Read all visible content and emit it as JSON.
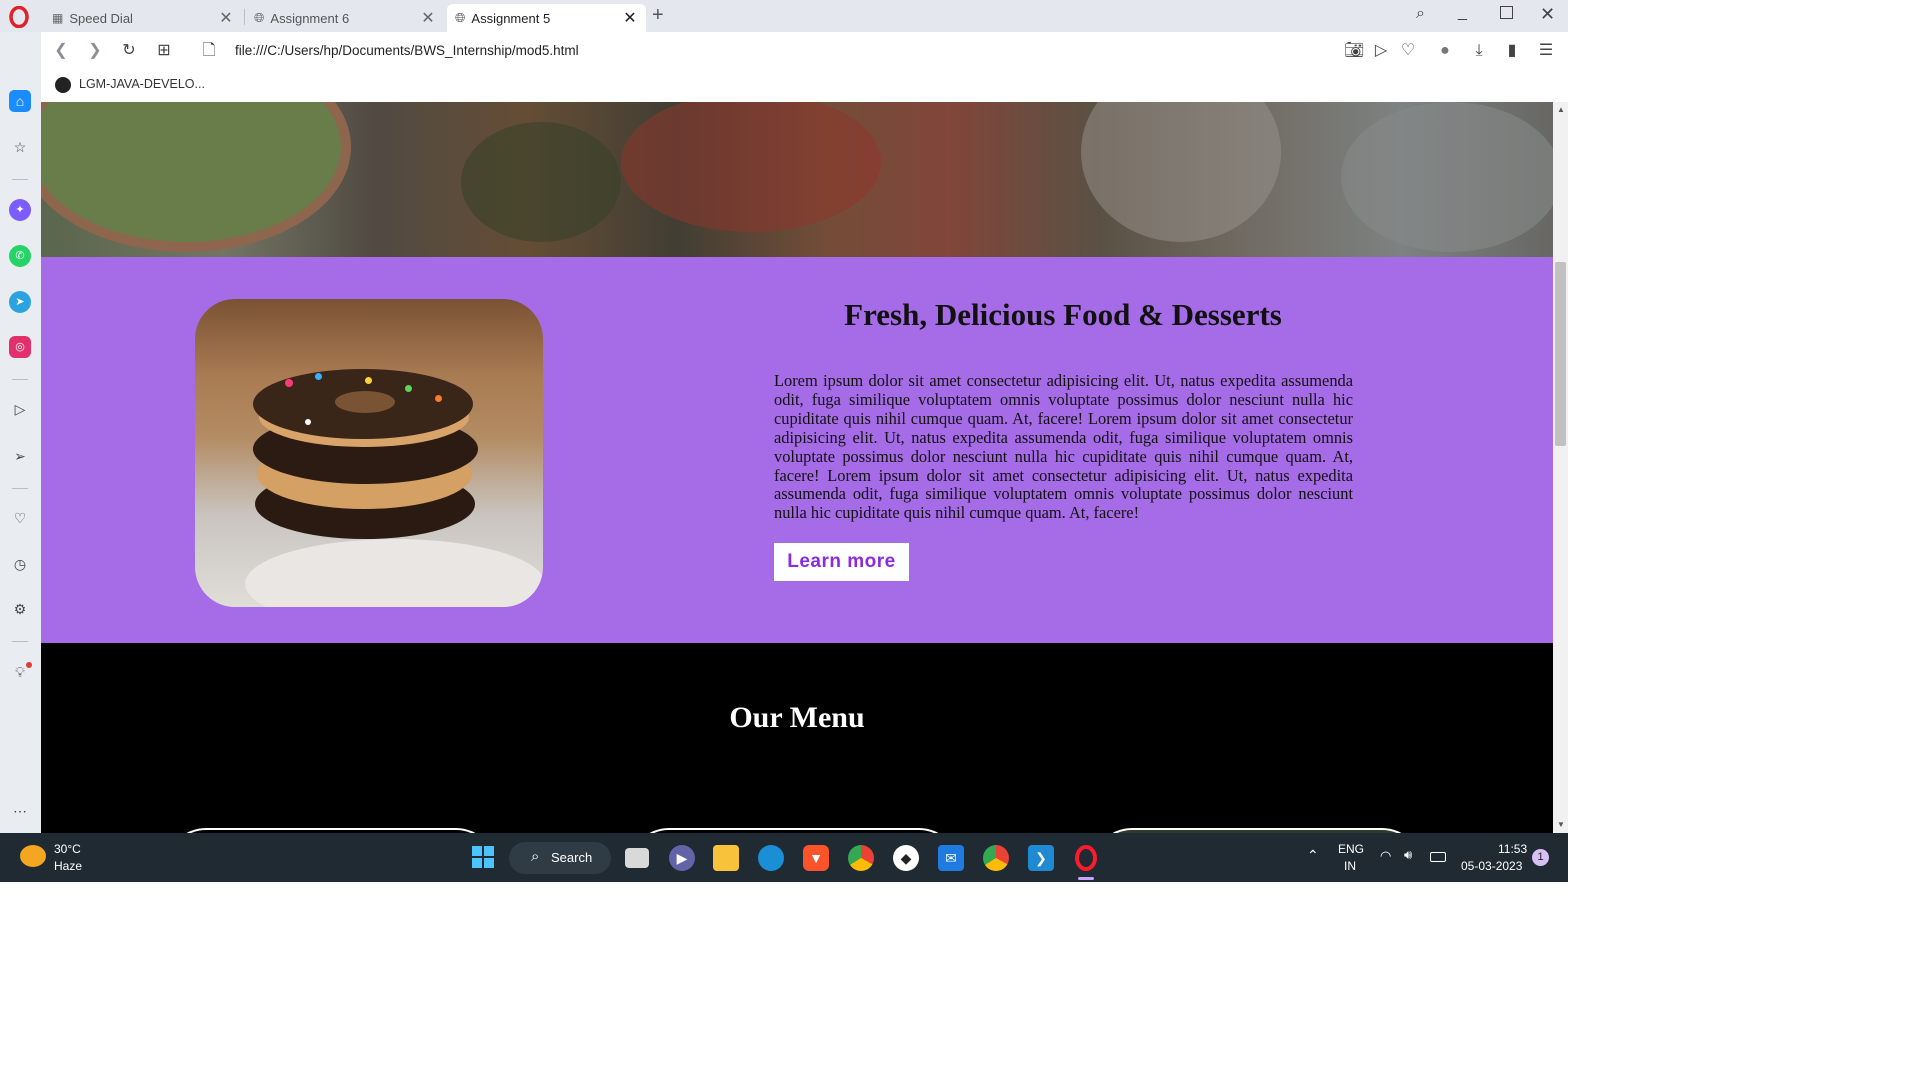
{
  "browser": {
    "tabs": [
      {
        "label": "Speed Dial",
        "active": false
      },
      {
        "label": "Assignment 6",
        "active": false
      },
      {
        "label": "Assignment 5",
        "active": true
      }
    ],
    "new_tab": "+",
    "url": "file:///C:/Users/hp/Documents/BWS_Internship/mod5.html",
    "bookmark": "LGM-JAVA-DEVELO..."
  },
  "page": {
    "heading": "Fresh, Delicious Food & Desserts",
    "paragraph": "Lorem ipsum dolor sit amet consectetur adipisicing elit. Ut, natus expedita assumenda odit, fuga similique voluptatem omnis voluptate possimus dolor nesciunt nulla hic cupiditate quis nihil cumque quam. At, facere! Lorem ipsum dolor sit amet consectetur adipisicing elit. Ut, natus expedita assumenda odit, fuga similique voluptatem omnis voluptate possimus dolor nesciunt nulla hic cupiditate quis nihil cumque quam. At, facere! Lorem ipsum dolor sit amet consectetur adipisicing elit. Ut, natus expedita assumenda odit, fuga similique voluptatem omnis voluptate possimus dolor nesciunt nulla hic cupiditate quis nihil cumque quam. At, facere!",
    "button": "Learn more",
    "menu_title": "Our Menu",
    "accent": "#a66be6",
    "button_text_color": "#8a2be2"
  },
  "taskbar": {
    "weather_temp": "30°C",
    "weather_desc": "Haze",
    "search": "Search",
    "lang_top": "ENG",
    "lang_bottom": "IN",
    "time": "11:53",
    "date": "05-03-2023",
    "notifications": "1"
  }
}
